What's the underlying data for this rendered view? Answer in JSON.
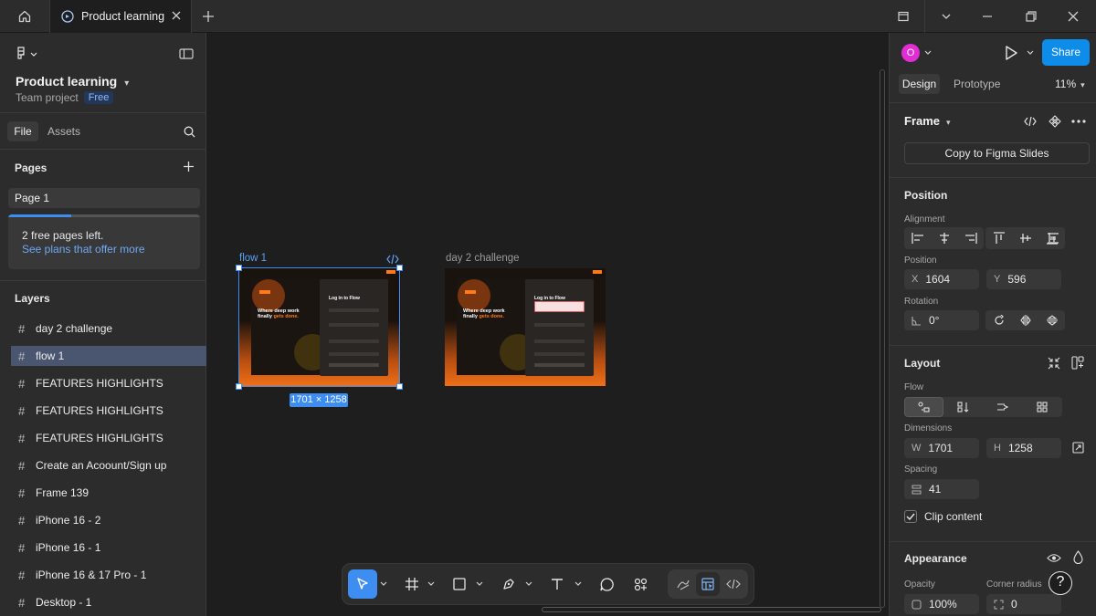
{
  "titlebar": {
    "tab_title": "Product learning"
  },
  "sidebar": {
    "project_title": "Product learning",
    "project_team": "Team project",
    "project_badge": "Free",
    "tab_file": "File",
    "tab_assets": "Assets",
    "pages_heading": "Pages",
    "pages": [
      {
        "label": "Page 1"
      }
    ],
    "free_pages_line1": "2 free pages left.",
    "free_pages_line2": "See plans that offer more",
    "free_pages_used_fraction": 0.33,
    "layers_heading": "Layers",
    "layers": [
      {
        "label": "day 2 challenge",
        "selected": false
      },
      {
        "label": "flow 1",
        "selected": true
      },
      {
        "label": "FEATURES HIGHLIGHTS",
        "selected": false
      },
      {
        "label": "FEATURES HIGHLIGHTS",
        "selected": false
      },
      {
        "label": "FEATURES HIGHLIGHTS",
        "selected": false
      },
      {
        "label": "Create an Acoount/Sign up",
        "selected": false
      },
      {
        "label": "Frame 139",
        "selected": false
      },
      {
        "label": "iPhone 16 - 2",
        "selected": false
      },
      {
        "label": "iPhone 16 - 1",
        "selected": false
      },
      {
        "label": "iPhone 16 & 17 Pro - 1",
        "selected": false
      },
      {
        "label": "Desktop - 1",
        "selected": false
      }
    ]
  },
  "canvas": {
    "frames": [
      {
        "label": "flow 1",
        "selected": true,
        "dimensions": "1701 × 1258",
        "heading_a": "Where deep work",
        "heading_b": "finally",
        "heading_c": "gets done.",
        "login_title": "Log in to Flow"
      },
      {
        "label": "day 2 challenge",
        "selected": false,
        "heading_a": "Where deep work",
        "heading_b": "finally",
        "heading_c": "gets done.",
        "login_title": "Log in to Flow"
      }
    ]
  },
  "toolbar": {
    "tools": [
      "move-tool",
      "frame-tool",
      "shape-tool",
      "pen-tool",
      "text-tool",
      "comment-tool",
      "actions-tool"
    ],
    "active_tool": "move-tool",
    "modes": [
      "draw-mode",
      "design-mode",
      "dev-mode"
    ]
  },
  "panel": {
    "avatar_initial": "O",
    "share_label": "Share",
    "tab_design": "Design",
    "tab_prototype": "Prototype",
    "zoom": "11%",
    "frame_title": "Frame",
    "copy_button": "Copy to Figma Slides",
    "position_heading": "Position",
    "alignment_label": "Alignment",
    "position_label": "Position",
    "x_label": "X",
    "x_value": "1604",
    "y_label": "Y",
    "y_value": "596",
    "rotation_label": "Rotation",
    "rotation_value": "0°",
    "layout_heading": "Layout",
    "flow_label": "Flow",
    "dimensions_label": "Dimensions",
    "w_label": "W",
    "w_value": "1701",
    "h_label": "H",
    "h_value": "1258",
    "spacing_label": "Spacing",
    "spacing_value": "41",
    "clip_content_label": "Clip content",
    "clip_content_checked": true,
    "appearance_heading": "Appearance",
    "opacity_label": "Opacity",
    "opacity_value": "100%",
    "corner_radius_label": "Corner radius",
    "corner_radius_value": "0"
  },
  "colors": {
    "accent": "#0d8ce9",
    "selection": "#3d8ef0",
    "avatar": "#e12dd4",
    "frame_orange": "#f07018"
  }
}
